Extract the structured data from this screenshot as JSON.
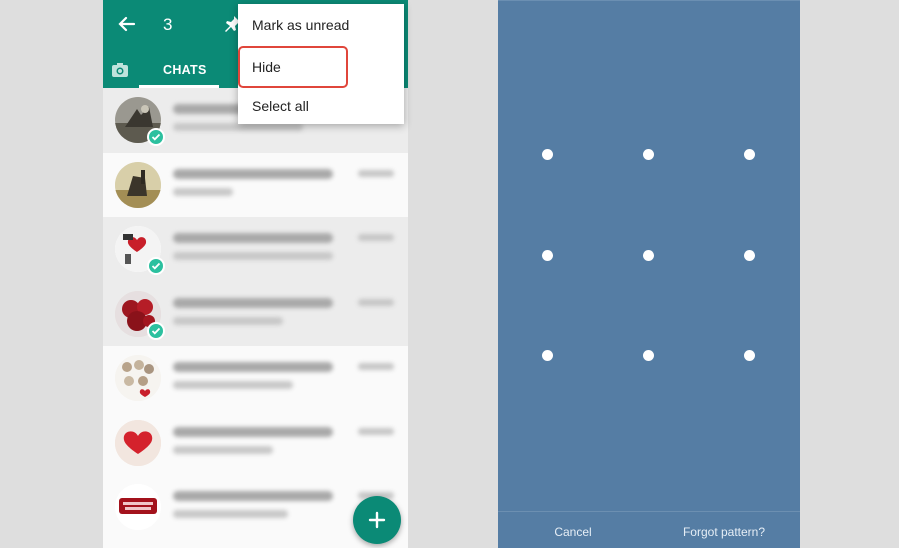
{
  "left_screen": {
    "appbar": {
      "back_icon": "arrow-back-icon",
      "selected_count": "3",
      "pin_icon": "pin-icon",
      "color": "#0b8a76"
    },
    "tabs": {
      "camera_icon": "camera-icon",
      "chats_label": "CHATS"
    },
    "menu": {
      "items": [
        "Mark as unread",
        "Hide",
        "Select all"
      ],
      "highlighted_item": "Hide",
      "highlight_color": "#e0463b"
    },
    "chats": [
      {
        "selected": true,
        "avatar": "photo-avatar"
      },
      {
        "selected": false,
        "avatar": "photo-avatar"
      },
      {
        "selected": true,
        "avatar": "sticker-avatar"
      },
      {
        "selected": true,
        "avatar": "roses-avatar"
      },
      {
        "selected": false,
        "avatar": "hearts-avatar"
      },
      {
        "selected": false,
        "avatar": "heart-avatar"
      },
      {
        "selected": false,
        "avatar": "text-logo-avatar"
      }
    ],
    "fab_icon": "plus-icon"
  },
  "right_screen": {
    "background": "#557da4",
    "pattern_dots": 9,
    "cancel_label": "Cancel",
    "forgot_label": "Forgot pattern?"
  }
}
